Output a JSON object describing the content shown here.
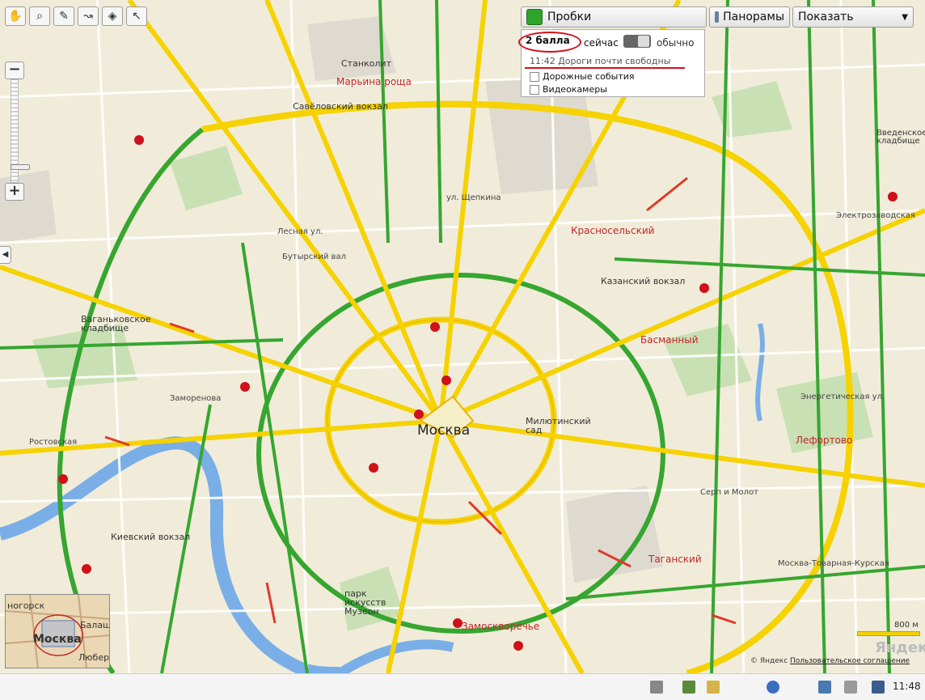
{
  "toolbar_left": {
    "tools": [
      {
        "name": "hand-tool-icon",
        "glyph": "✋"
      },
      {
        "name": "magnifier-tool-icon",
        "glyph": "🔍"
      },
      {
        "name": "ruler-tool-icon",
        "glyph": "📏"
      },
      {
        "name": "route-tool-icon",
        "glyph": "➰"
      },
      {
        "name": "layers-tool-icon",
        "glyph": "◈"
      },
      {
        "name": "pointer-tool-icon",
        "glyph": "↖"
      }
    ]
  },
  "zoom": {
    "minus": "−",
    "plus": "+",
    "level_fraction": 0.86
  },
  "top_right": {
    "traffic_label": "Пробки",
    "panoramas_label": "Панорамы",
    "show_label": "Показать",
    "show_arrow": "▼"
  },
  "traffic_panel": {
    "score": "2 балла",
    "now": "сейчас",
    "usual": "обычно",
    "status": "11:42 Дороги почти свободны",
    "options": [
      "Дорожные события",
      "Видеокамеры"
    ]
  },
  "map_labels": {
    "city": "Москва",
    "districts": [
      "Марьина роща",
      "Красносельский",
      "Басманный",
      "Лефортово",
      "Таганский",
      "Замоскворечье"
    ],
    "places": [
      "Станколит",
      "Савёловский вокзал",
      "Ваганьковское кладбище",
      "Казанский вокзал",
      "Киевский вокзал",
      "Введенское кладбище",
      "Милютинский сад",
      "парк искусств Музеон",
      "Электрозаводская",
      "Заморенова",
      "Москва-Товарная-Курская",
      "Серп и Молот",
      "Энергетическая ул.",
      "Лесная ул.",
      "Ростовская",
      "ул. Щепкина",
      "Бутырский вал"
    ]
  },
  "overview": {
    "labels": [
      "ногорск",
      "Балаш",
      "Москва",
      "Люберц"
    ]
  },
  "scale": {
    "label": "800 м"
  },
  "branding": {
    "logo": "Яндекс"
  },
  "copyright": {
    "text": "© Яндекс",
    "link": "Пользовательское соглашение"
  },
  "taskbar": {
    "clock": "11:48"
  },
  "colors": {
    "traffic_free": "#36a630",
    "traffic_medium": "#f5d200",
    "traffic_jam": "#e0392b",
    "map_bg": "#f1ecd9",
    "park": "#c5deb0",
    "river": "#6aa0e0"
  }
}
